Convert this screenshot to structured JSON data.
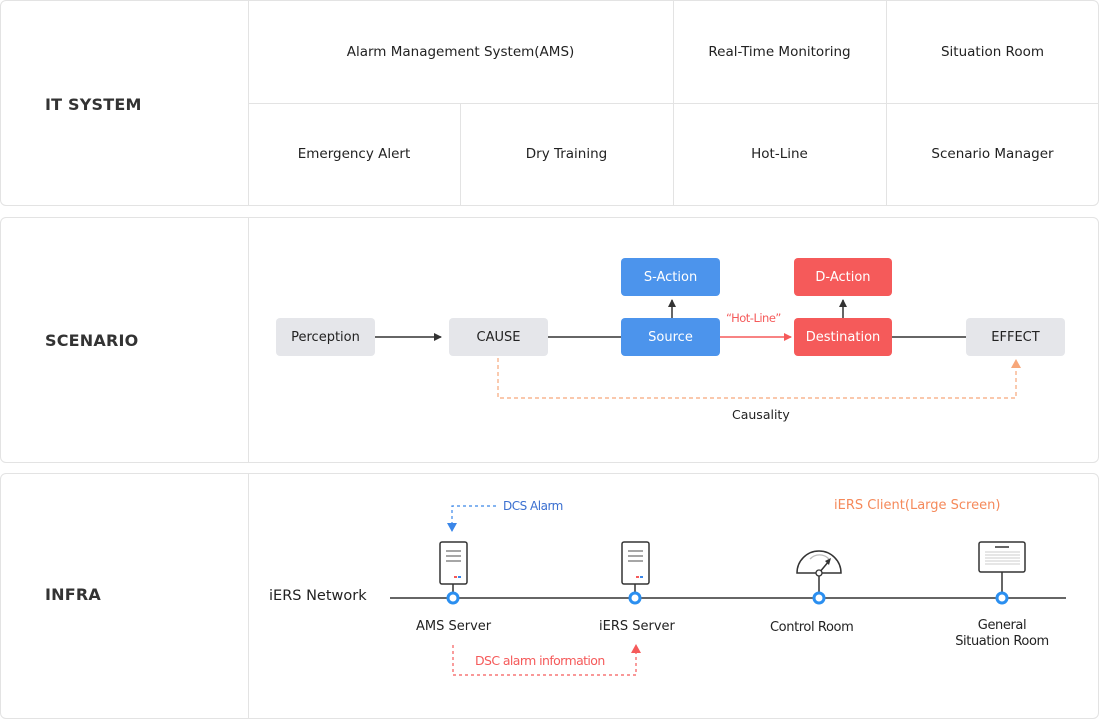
{
  "it_system": {
    "label": "IT SYSTEM",
    "row1": [
      "Alarm Management System(AMS)",
      "Real-Time Monitoring",
      "Situation Room"
    ],
    "row2": [
      "Emergency Alert",
      "Dry Training",
      "Hot-Line",
      "Scenario Manager"
    ]
  },
  "scenario": {
    "label": "SCENARIO",
    "nodes": {
      "perception": "Perception",
      "cause": "CAUSE",
      "source": "Source",
      "s_action": "S-Action",
      "destination": "Destination",
      "d_action": "D-Action",
      "effect": "EFFECT"
    },
    "hotline_label": "“Hot-Line”",
    "causality_label": "Causality"
  },
  "infra": {
    "label": "INFRA",
    "network_label": "iERS Network",
    "dcs_alarm_label": "DCS Alarm",
    "client_label": "iERS Client(Large Screen)",
    "dsc_info_label": "DSC alarm information",
    "nodes": [
      "AMS Server",
      "iERS Server",
      "Control Room",
      "General",
      "Situation Room"
    ]
  },
  "colors": {
    "blue": "#4c94ec",
    "red": "#f55a5a",
    "orange": "#f7a77a",
    "gray_box": "#e5e6ea",
    "node_blue": "#2b8ff0"
  }
}
